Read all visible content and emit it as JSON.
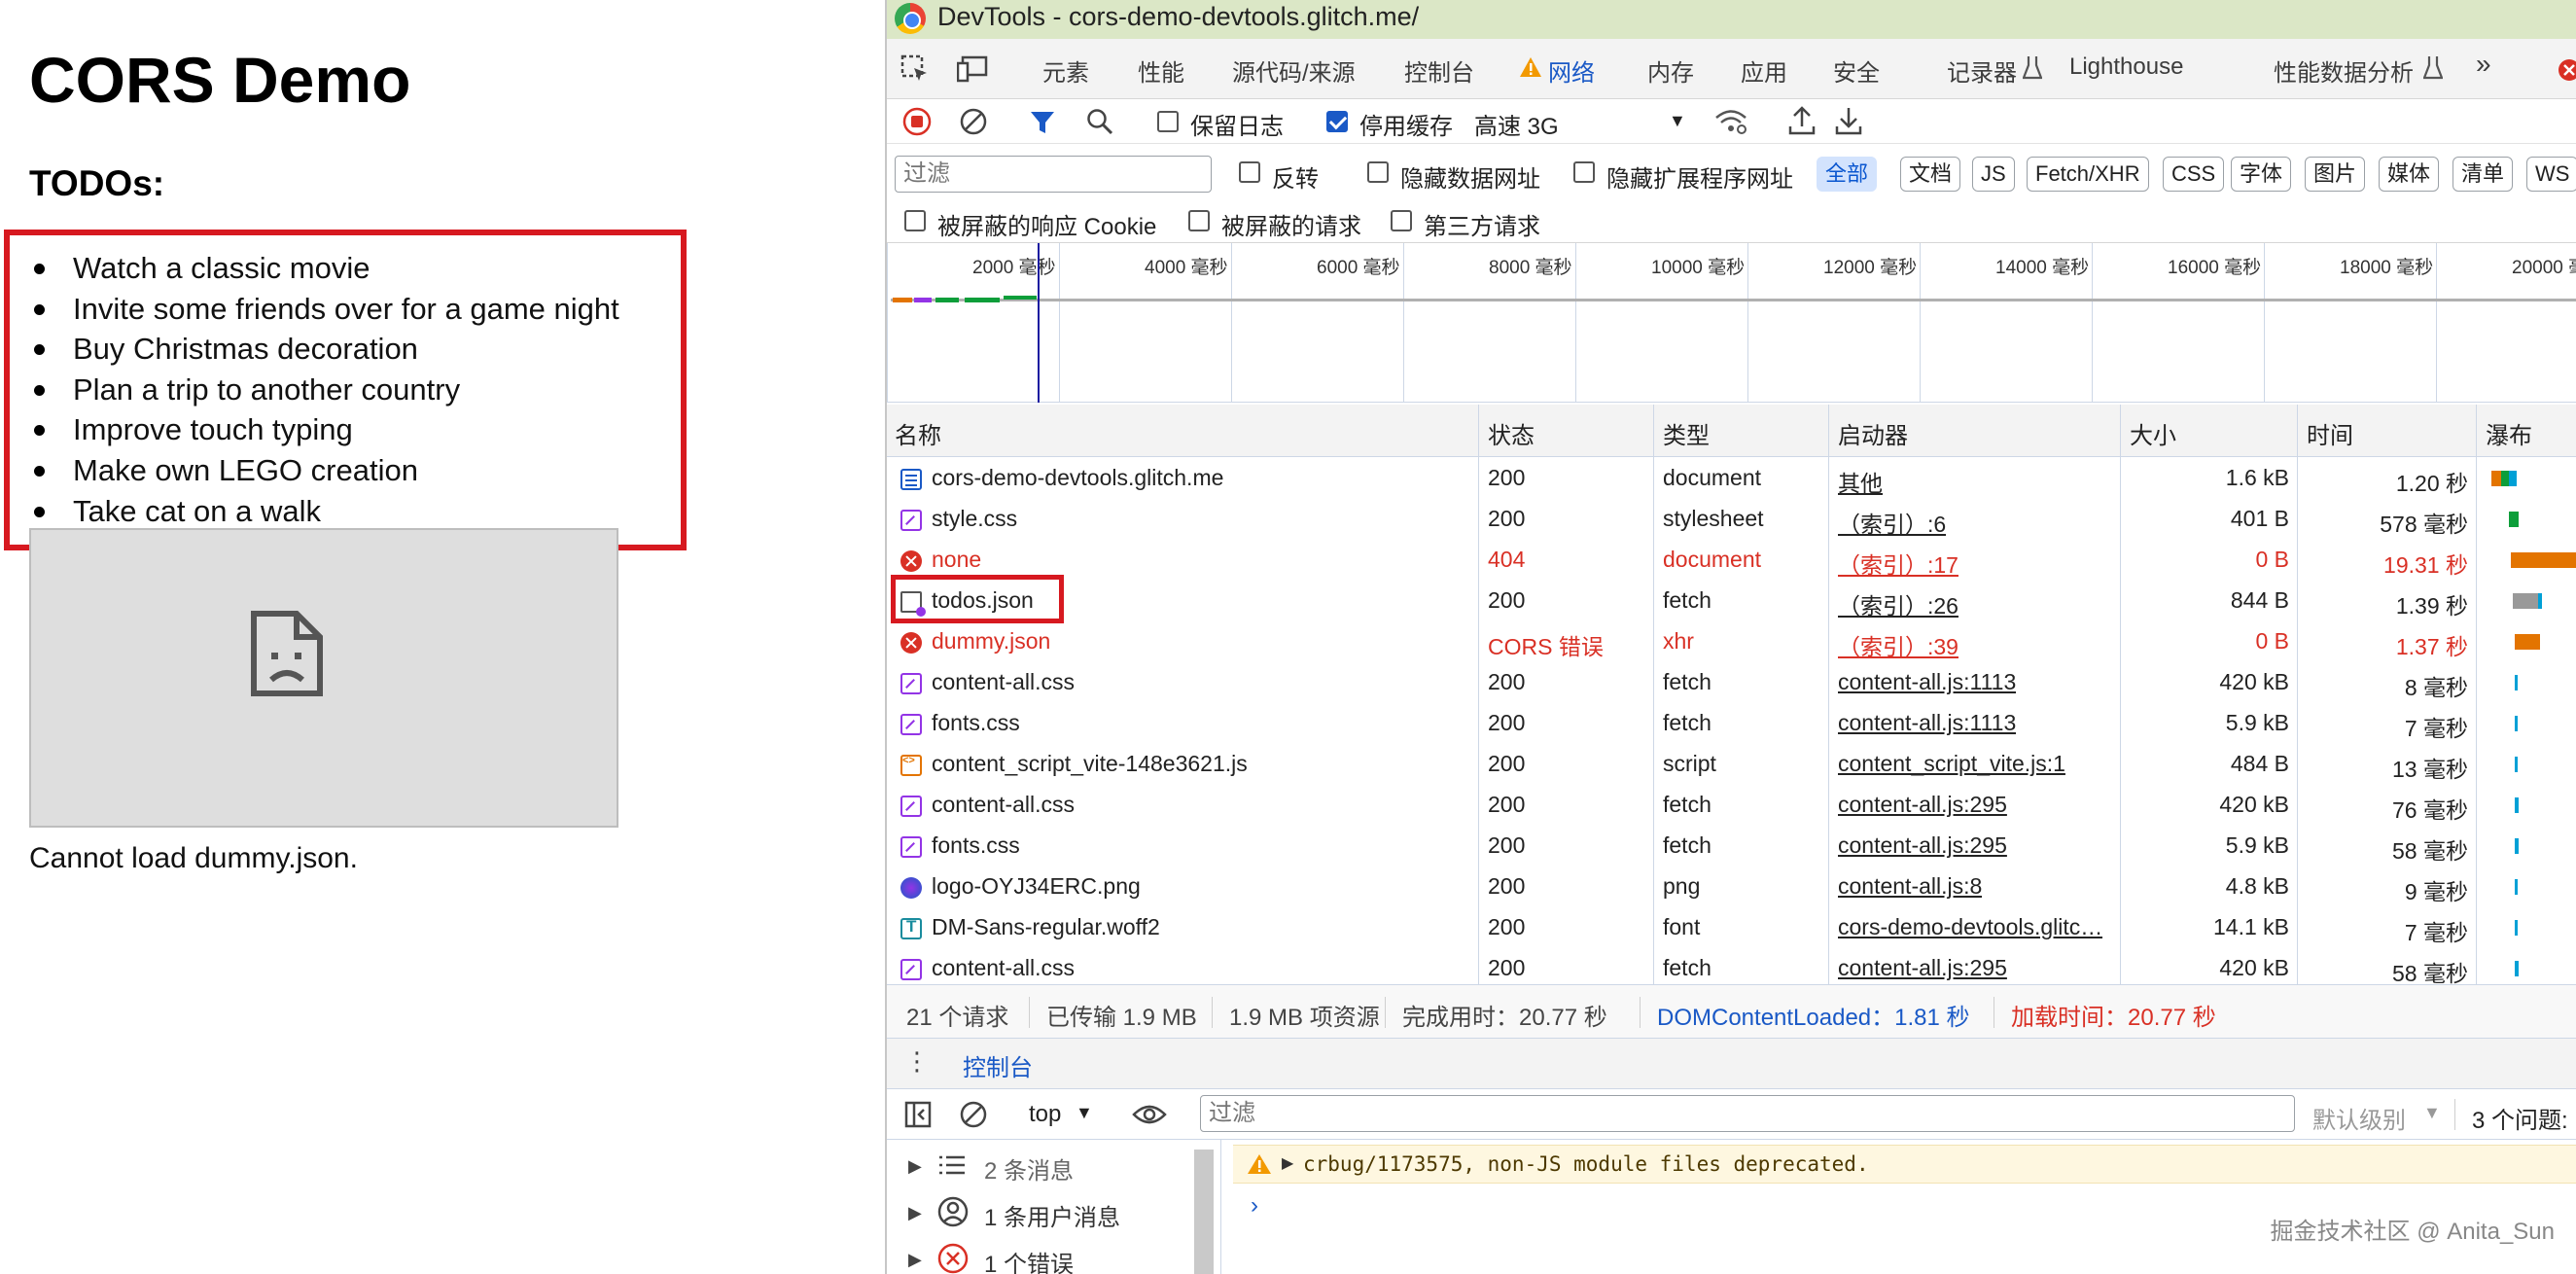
{
  "page": {
    "heading": "CORS Demo",
    "subheading": "TODOs:",
    "todos": [
      "Watch a classic movie",
      "Invite some friends over for a game night",
      "Buy Christmas decoration",
      "Plan a trip to another country",
      "Improve touch typing",
      "Make own LEGO creation",
      "Take cat on a walk"
    ],
    "error_message": "Cannot load dummy.json."
  },
  "devtools": {
    "window_title": "DevTools - cors-demo-devtools.glitch.me/",
    "tabs": [
      "元素",
      "性能",
      "源代码/来源",
      "控制台",
      "网络",
      "内存",
      "应用",
      "安全",
      "记录器",
      "Lighthouse",
      "性能数据分析"
    ],
    "active_tab": "网络",
    "toolbar": {
      "preserve_log": "保留日志",
      "disable_cache": "停用缓存",
      "throttling": "高速 3G"
    },
    "filter": {
      "placeholder": "过滤",
      "invert": "反转",
      "hide_data_urls": "隐藏数据网址",
      "hide_extension_urls": "隐藏扩展程序网址",
      "types": [
        "全部",
        "文档",
        "JS",
        "Fetch/XHR",
        "CSS",
        "字体",
        "图片",
        "媒体",
        "清单",
        "WS"
      ],
      "blocked_cookies": "被屏蔽的响应 Cookie",
      "blocked_requests": "被屏蔽的请求",
      "third_party": "第三方请求"
    },
    "timeline_ticks": [
      "2000 毫秒",
      "4000 毫秒",
      "6000 毫秒",
      "8000 毫秒",
      "10000 毫秒",
      "12000 毫秒",
      "14000 毫秒",
      "16000 毫秒",
      "18000 毫秒",
      "20000 毫"
    ],
    "columns": [
      "名称",
      "状态",
      "类型",
      "启动器",
      "大小",
      "时间",
      "瀑布"
    ],
    "requests": [
      {
        "name": "cors-demo-devtools.glitch.me",
        "status": "200",
        "type": "document",
        "initiator": "其他",
        "size": "1.6 kB",
        "time": "1.20 秒",
        "icon": "doc",
        "error": false
      },
      {
        "name": "style.css",
        "status": "200",
        "type": "stylesheet",
        "initiator": "（索引）:6",
        "size": "401 B",
        "time": "578 毫秒",
        "icon": "css",
        "error": false
      },
      {
        "name": "none",
        "status": "404",
        "type": "document",
        "initiator": "（索引）:17",
        "size": "0 B",
        "time": "19.31 秒",
        "icon": "err",
        "error": true
      },
      {
        "name": "todos.json",
        "status": "200",
        "type": "fetch",
        "initiator": "（索引）:26",
        "size": "844 B",
        "time": "1.39 秒",
        "icon": "fetch",
        "error": false
      },
      {
        "name": "dummy.json",
        "status": "CORS 错误",
        "type": "xhr",
        "initiator": "（索引）:39",
        "size": "0 B",
        "time": "1.37 秒",
        "icon": "err",
        "error": true
      },
      {
        "name": "content-all.css",
        "status": "200",
        "type": "fetch",
        "initiator": "content-all.js:1113",
        "size": "420 kB",
        "time": "8 毫秒",
        "icon": "css",
        "error": false
      },
      {
        "name": "fonts.css",
        "status": "200",
        "type": "fetch",
        "initiator": "content-all.js:1113",
        "size": "5.9 kB",
        "time": "7 毫秒",
        "icon": "css",
        "error": false
      },
      {
        "name": "content_script_vite-148e3621.js",
        "status": "200",
        "type": "script",
        "initiator": "content_script_vite.js:1",
        "size": "484 B",
        "time": "13 毫秒",
        "icon": "script",
        "error": false
      },
      {
        "name": "content-all.css",
        "status": "200",
        "type": "fetch",
        "initiator": "content-all.js:295",
        "size": "420 kB",
        "time": "76 毫秒",
        "icon": "css",
        "error": false
      },
      {
        "name": "fonts.css",
        "status": "200",
        "type": "fetch",
        "initiator": "content-all.js:295",
        "size": "5.9 kB",
        "time": "58 毫秒",
        "icon": "css",
        "error": false
      },
      {
        "name": "logo-OYJ34ERC.png",
        "status": "200",
        "type": "png",
        "initiator": "content-all.js:8",
        "size": "4.8 kB",
        "time": "9 毫秒",
        "icon": "png",
        "error": false
      },
      {
        "name": "DM-Sans-regular.woff2",
        "status": "200",
        "type": "font",
        "initiator": "cors-demo-devtools.glitc…",
        "size": "14.1 kB",
        "time": "7 毫秒",
        "icon": "font",
        "error": false
      },
      {
        "name": "content-all.css",
        "status": "200",
        "type": "fetch",
        "initiator": "content-all.js:295",
        "size": "420 kB",
        "time": "58 毫秒",
        "icon": "css",
        "error": false
      }
    ],
    "summary": {
      "requests": "21 个请求",
      "transferred": "已传输 1.9 MB",
      "resources": "1.9 MB 项资源",
      "finish": "完成用时：20.77 秒",
      "dom_loaded": "DOMContentLoaded：1.81 秒",
      "load": "加载时间：20.77 秒"
    },
    "drawer": {
      "console_tab": "控制台",
      "context": "top",
      "filter_placeholder": "过滤",
      "level": "默认级别",
      "issues": "3 个问题:",
      "sidebar": [
        "2 条消息",
        "1 条用户消息",
        "1 个错误"
      ],
      "warning": "crbug/1173575, non-JS module files deprecated.",
      "prompt": "›"
    },
    "watermark": "掘金技术社区 @ Anita_Sun"
  },
  "colors": {
    "accent": "#1a59c6",
    "error": "#d93025",
    "highlight": "#d71920",
    "titlebar": "#dbe7c6"
  }
}
